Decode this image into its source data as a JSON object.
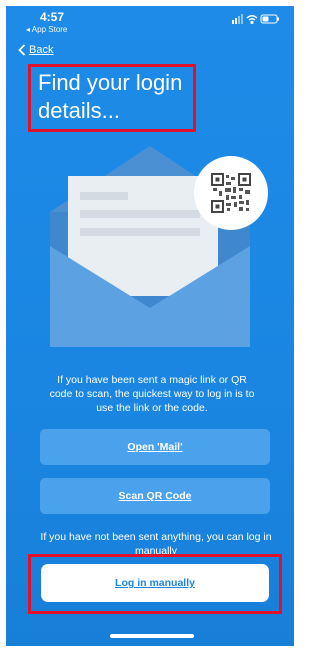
{
  "status_bar": {
    "time": "4:57",
    "back_app": "◂ App Store"
  },
  "nav": {
    "back_label": "Back"
  },
  "title": "Find your login details...",
  "info_text": "If you have been sent a magic link or QR code to scan, the quickest way to log in is to use the link or the code.",
  "buttons": {
    "open_mail": "Open 'Mail'",
    "scan_qr": "Scan QR Code",
    "log_in_manually": "Log in manually"
  },
  "manual_hint": "If you have not been sent anything, you can log in manually",
  "colors": {
    "background": "#1a86e2",
    "button": "#4aa1ec",
    "highlight": "#e0112b",
    "envelope_back": "#4a90d2",
    "envelope_front": "#5ca2e2"
  },
  "icons": [
    "chevron-left-icon",
    "signal-icon",
    "wifi-icon",
    "battery-icon",
    "envelope-icon",
    "qr-code-icon"
  ]
}
